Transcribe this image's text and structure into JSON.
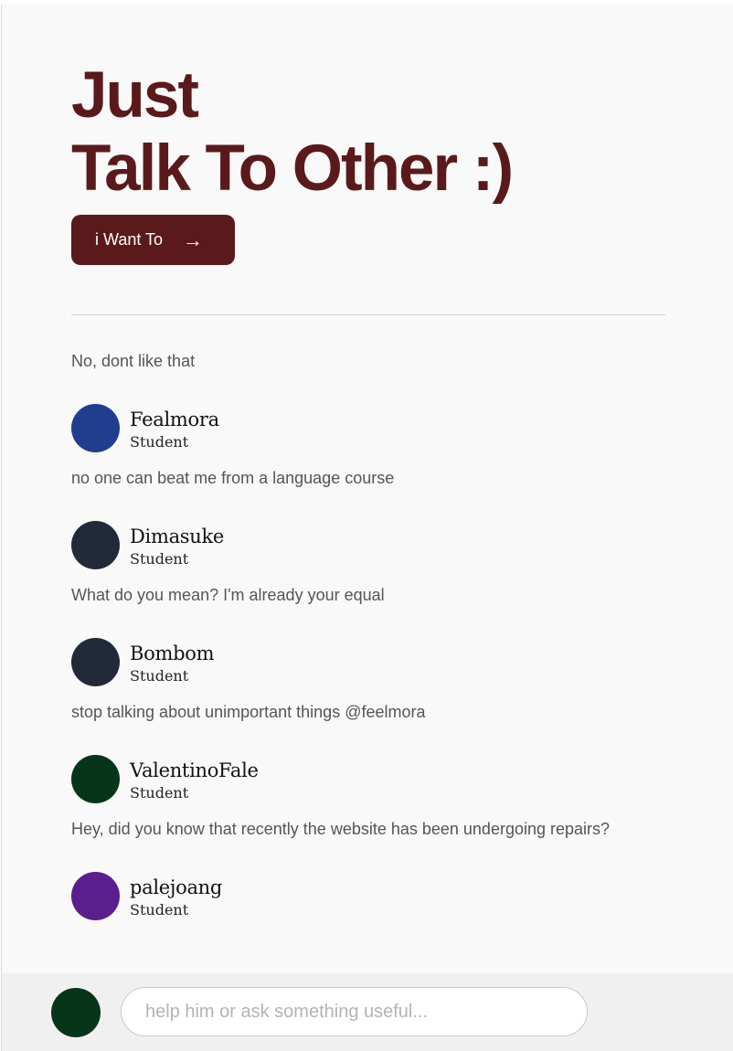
{
  "hero": {
    "title_line1": "Just",
    "title_line2": "Talk To Other :)",
    "cta_label": "i Want To",
    "cta_icon": "arrow-right-icon"
  },
  "colors": {
    "brand": "#5a1a1b",
    "background": "#f9f9f9"
  },
  "messages": [
    {
      "name": "",
      "role": "Student",
      "text": "No, dont like that",
      "avatar_color": "#06351a"
    },
    {
      "name": "Fealmora",
      "role": "Student",
      "text": "no one can beat me from a language course",
      "avatar_color": "#213d8d"
    },
    {
      "name": "Dimasuke",
      "role": "Student",
      "text": "What do you mean? I'm already your equal",
      "avatar_color": "#222a3a"
    },
    {
      "name": "Bombom",
      "role": "Student",
      "text": "stop talking about unimportant things @feelmora",
      "avatar_color": "#222a3a"
    },
    {
      "name": "ValentinoFale",
      "role": "Student",
      "text": "Hey, did you know that recently the website has been undergoing repairs?",
      "avatar_color": "#06351a"
    },
    {
      "name": "palejoang",
      "role": "Student",
      "text": "",
      "avatar_color": "#5a1f8d"
    }
  ],
  "composer": {
    "placeholder": "help him or ask something useful...",
    "value": "",
    "avatar_color": "#06351a"
  }
}
